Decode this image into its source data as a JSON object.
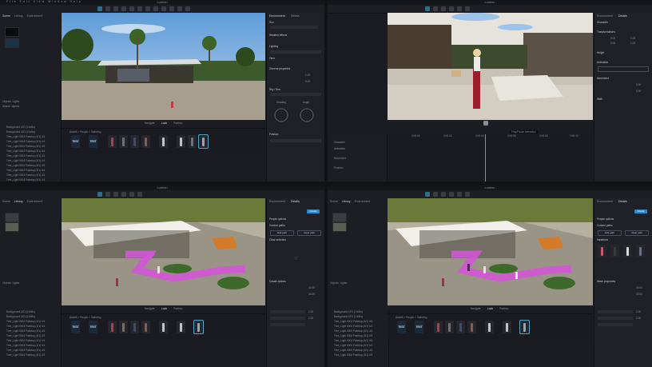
{
  "app": {
    "title": "Lumion",
    "menu": "File  Edit  View  Window  Help"
  },
  "quadrant_tl": {
    "left_tabs": [
      "Scene",
      "Library",
      "Environment"
    ],
    "outliner_tabs": [
      "Objects",
      "Lights"
    ],
    "search_placeholder": "Search objects",
    "outliner_items": [
      "Background 1/01 (1/x/Bo)",
      "Background 1/01 (1/x/Bo)",
      "Tree_Light 0004 Palmtop (4/1) 4/1",
      "Tree_Light 0004 Palmtop (4/1) 4/1",
      "Tree_Light 0004 Palmtop (4/1) 4/1",
      "Tree_Light 0004 Palmtop (4/1) 4/1",
      "Tree_Light 0004 Palmtop (4/1) 4/1",
      "Tree_Light 0004 Palmtop (4/1) 4/1",
      "Tree_Light 0004 Palmtop (4/1) 4/1",
      "Tree_Light 0004 Palmtop (4/1) 4/1",
      "Tree_Light 0004 Palmtop (4/1) 4/1",
      "Tree_Light 0004 Palmtop (4/1) 4/1"
    ],
    "viewport_modes": [
      "Navigate",
      "Look",
      "Position"
    ],
    "asset_bar_path": "Assets > People > Standing",
    "assets": [
      "TEST",
      "TEST",
      "",
      "",
      "",
      "",
      "",
      "",
      "",
      ""
    ],
    "right_tabs": [
      "Environment",
      "Details"
    ],
    "right_sections": [
      "Sun",
      "Weather effects",
      "Lighting",
      "Time",
      "Day / Night",
      "General properties",
      "Sky / Sun",
      "Clouds",
      "Position"
    ],
    "values": [
      "0.00",
      "0.00",
      "1.00",
      "5.00"
    ],
    "dial_labels": [
      "Heading",
      "Angle"
    ]
  },
  "quadrant_tr": {
    "right_tabs": [
      "Environment",
      "Details"
    ],
    "right_sections": [
      "Character",
      "Transformations",
      "Height",
      "Animation",
      "Movement",
      "Walk"
    ],
    "values": [
      "0.00",
      "1.00",
      "0.00",
      "1.00",
      "0.00",
      "0.00"
    ],
    "timeline_labels": [
      "Character",
      "Animation",
      "Movement",
      "Position"
    ],
    "timeline_ticks": [
      "0:00:00",
      "0:00:01",
      "0:00:02",
      "0:00:03",
      "0:00:04",
      "0:00:05",
      "0:00:06",
      "0:00:07",
      "0:00:08",
      "0:00:09",
      "0:00:10"
    ],
    "tooltip": "Play/Pause animation"
  },
  "quadrant_bl": {
    "left_tabs": [
      "Scene",
      "Library",
      "Environment"
    ],
    "outliner_tabs": [
      "Objects",
      "Lights"
    ],
    "outliner_items": [
      "Background 1/01 (1/x/Bo)",
      "Background 1/01 (1/x/Bo)",
      "Tree_Light 0004 Palmtop (4/1) 4/1",
      "Tree_Light 0004 Palmtop (4/1) 4/1",
      "Tree_Light 0004 Palmtop (4/1) 4/1",
      "Tree_Light 0004 Palmtop (4/1) 4/1",
      "Tree_Light 0004 Palmtop (4/1) 4/1",
      "Tree_Light 0004 Palmtop (4/1) 4/1",
      "Tree_Light 0004 Palmtop (4/1) 4/1",
      "Tree_Light 0004 Palmtop (4/1) 4/1"
    ],
    "right_tabs": [
      "Environment",
      "Details"
    ],
    "right_sections": [
      "People options",
      "Custom paths",
      "Clear selection",
      "Create options"
    ],
    "buttons": [
      "Create",
      "Edit path",
      "Clear path"
    ],
    "values": [
      "40.00",
      "30.00",
      "1.00",
      "1.00"
    ],
    "viewport_modes": [
      "Navigate",
      "Look",
      "Position"
    ],
    "asset_bar_path": "Assets > People > Standing",
    "assets": [
      "TEST",
      "TEST",
      "",
      "",
      "",
      "",
      "",
      "",
      "",
      ""
    ]
  },
  "quadrant_br": {
    "left_tabs": [
      "Scene",
      "Library",
      "Environment"
    ],
    "outliner_tabs": [
      "Objects",
      "Lights"
    ],
    "outliner_items": [
      "Background 1/01 (1/x/Bo)",
      "Background 1/01 (1/x/Bo)",
      "Tree_Light 0004 Palmtop (4/1) 4/1",
      "Tree_Light 0004 Palmtop (4/1) 4/1",
      "Tree_Light 0004 Palmtop (4/1) 4/1",
      "Tree_Light 0004 Palmtop (4/1) 4/1",
      "Tree_Light 0004 Palmtop (4/1) 4/1",
      "Tree_Light 0004 Palmtop (4/1) 4/1",
      "Tree_Light 0004 Palmtop (4/1) 4/1",
      "Tree_Light 0004 Palmtop (4/1) 4/1"
    ],
    "right_tabs": [
      "Environment",
      "Details"
    ],
    "right_sections": [
      "People options",
      "Custom paths",
      "Variations",
      "Wave properties"
    ],
    "buttons": [
      "Create",
      "Edit path",
      "Clear path"
    ],
    "values": [
      "40.00",
      "30.00",
      "1.00",
      "1.00"
    ],
    "viewport_modes": [
      "Navigate",
      "Look",
      "Position"
    ],
    "asset_bar_path": "Assets > People > Standing",
    "assets": [
      "TEST",
      "TEST",
      "",
      "",
      "",
      "",
      "",
      "",
      "",
      ""
    ]
  },
  "colors": {
    "accent": "#2b8ad0",
    "path": "#d355d6",
    "panel": "#1b1c21",
    "active": "#4fa3c7"
  }
}
